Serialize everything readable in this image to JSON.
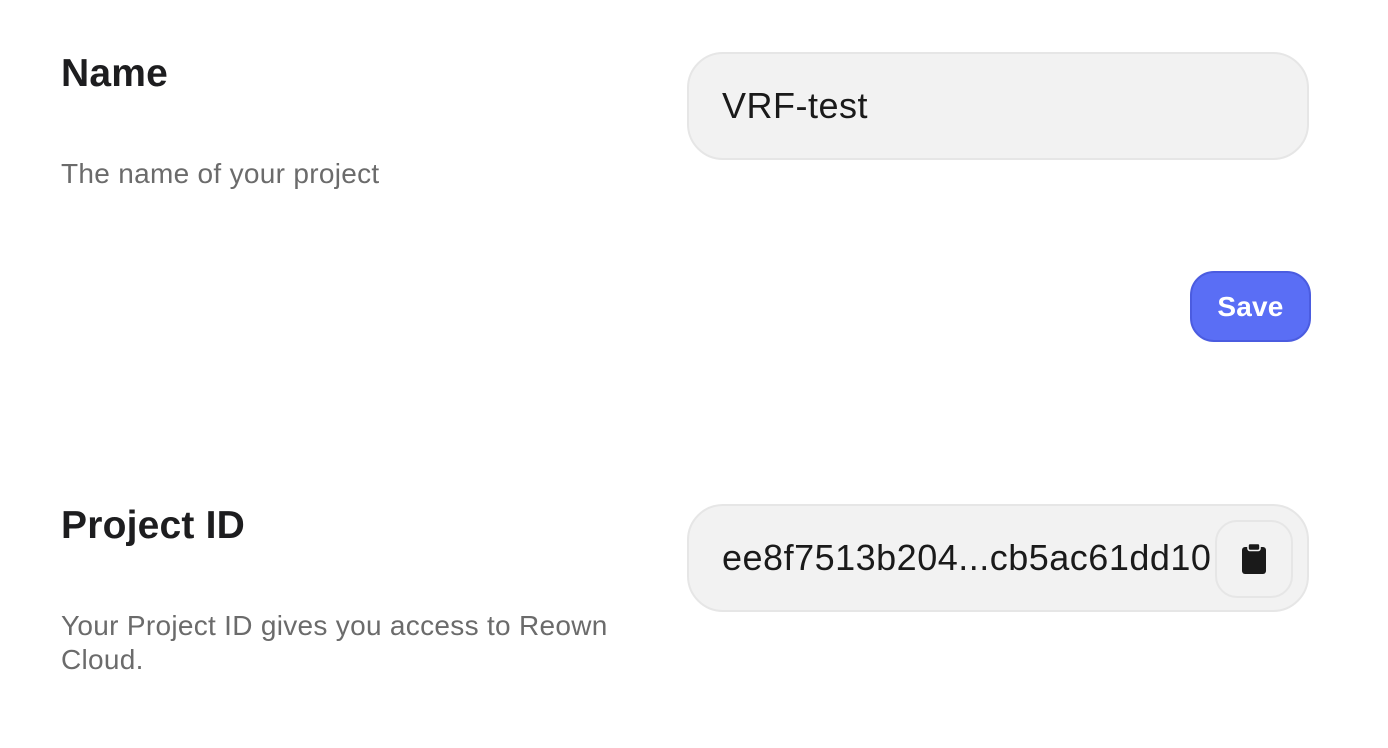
{
  "name_section": {
    "title": "Name",
    "description": "The name of your project",
    "input_value": "VRF-test",
    "save_label": "Save"
  },
  "project_id_section": {
    "title": "Project ID",
    "description": "Your Project ID gives you access to Reown Cloud.",
    "value": "ee8f7513b204...cb5ac61dd10",
    "copy_icon": "clipboard-icon"
  },
  "colors": {
    "accent": "#5a6ef5",
    "field_background": "#f2f2f2",
    "muted_text": "#6b6b6b"
  }
}
